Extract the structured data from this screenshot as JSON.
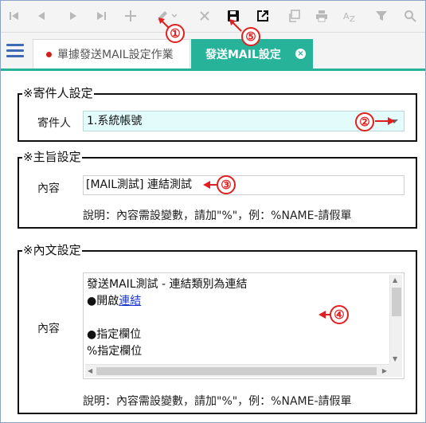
{
  "toolbar": {
    "buttons": [
      {
        "name": "first-icon",
        "glyph": "|◀"
      },
      {
        "name": "prev-icon",
        "glyph": "◀"
      },
      {
        "name": "next-icon",
        "glyph": "▶"
      },
      {
        "name": "last-icon",
        "glyph": "▶|"
      },
      {
        "name": "add-icon",
        "glyph": "+"
      },
      {
        "name": "edit-icon",
        "glyph": "✎"
      },
      {
        "name": "delete-icon",
        "glyph": "✕"
      },
      {
        "name": "save-icon",
        "glyph": "save"
      },
      {
        "name": "open-external-icon",
        "glyph": "external"
      },
      {
        "name": "copy-icon",
        "glyph": "copy"
      },
      {
        "name": "print-icon",
        "glyph": "print"
      },
      {
        "name": "sort-icon",
        "glyph": "AZ"
      },
      {
        "name": "filter-icon",
        "glyph": "filter"
      },
      {
        "name": "search-icon",
        "glyph": "search"
      }
    ]
  },
  "markers": [
    "①",
    "②",
    "③",
    "④",
    "⑤"
  ],
  "tabs": {
    "tab1_label": "單據發送MAIL設定作業",
    "tab2_label": "發送MAIL設定",
    "close_glyph": "×"
  },
  "sender_section": {
    "legend": "※寄件人設定",
    "label": "寄件人",
    "selected_value": "1.系統帳號"
  },
  "subject_section": {
    "legend": "※主旨設定",
    "label": "內容",
    "value": "[MAIL測試] 連結測試",
    "note": "說明：內容需設變數，請加\"%\"，例：%NAME-請假單"
  },
  "body_section": {
    "legend": "※內文設定",
    "label": "內容",
    "lines": {
      "l1": "發送MAIL測試 - 連結類別為連結",
      "l2_prefix": "●開啟",
      "l2_link": "連結",
      "l3": "",
      "l4": "●指定欄位",
      "l5": "%指定欄位"
    },
    "note": "說明：內容需設變數，請加\"%\"，例：%NAME-請假單"
  },
  "colors": {
    "accent": "#27b39a",
    "marker": "#e02020",
    "select_bg": "#e3fbfb",
    "link": "#1a33cc"
  }
}
